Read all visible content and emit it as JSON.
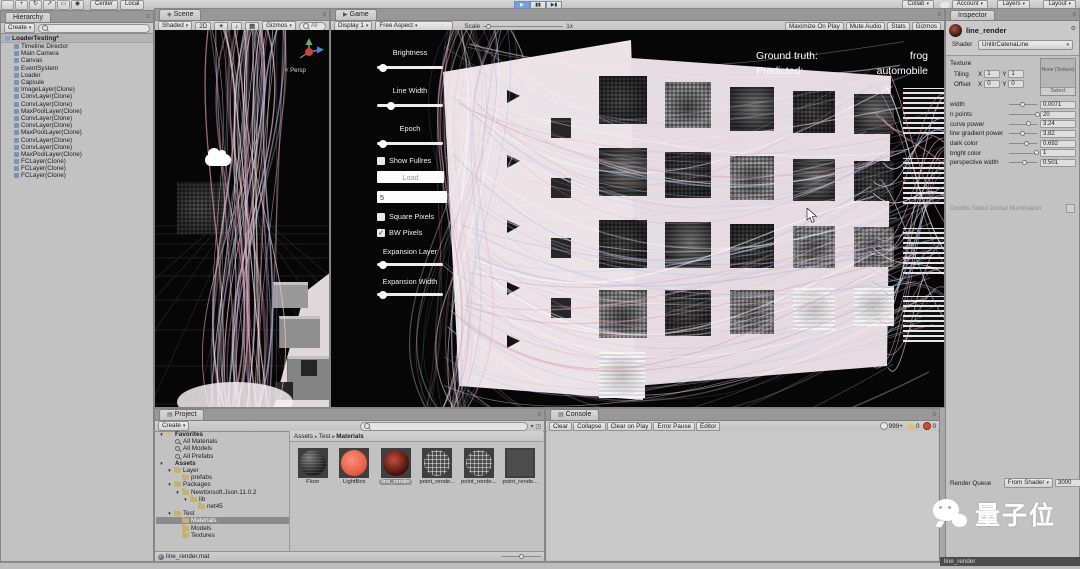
{
  "toolbar": {
    "pivot": "Center",
    "space": "Local",
    "collab": "Collab",
    "account": "Account",
    "layers": "Layers",
    "layout": "Layout"
  },
  "hierarchy": {
    "tab": "Hierarchy",
    "create_label": "Create",
    "root": "LoaderTesting*",
    "items": [
      "Timeline Director",
      "Main Camera",
      "Canvas",
      "EventSystem",
      "Loader",
      "Capsule",
      "ImageLayer(Clone)",
      "ConvLayer(Clone)",
      "ConvLayer(Clone)",
      "MaxPoolLayer(Clone)",
      "ConvLayer(Clone)",
      "ConvLayer(Clone)",
      "MaxPoolLayer(Clone)",
      "ConvLayer(Clone)",
      "ConvLayer(Clone)",
      "MaxPoolLayer(Clone)",
      "FCLayer(Clone)",
      "FCLayer(Clone)",
      "FCLayer(Clone)"
    ]
  },
  "scene": {
    "tab": "Scene",
    "shaded": "Shaded",
    "mode2d": "2D",
    "gizmos": "Gizmos",
    "search": "All",
    "persp": "< Persp"
  },
  "game": {
    "tab": "Game",
    "display": "Display 1",
    "aspect": "Free Aspect",
    "scale_label": "Scale",
    "scale_value": "1x",
    "right_buttons": [
      "Maximize On Play",
      "Mute Audio",
      "Stats",
      "Gizmos"
    ],
    "controls": {
      "brightness": "Brightness",
      "line_width": "Line Width",
      "epoch": "Epoch",
      "show_fullres": "Show Fullres",
      "load": "Load",
      "input_value": "5",
      "square_pixels": "Square Pixels",
      "bw_pixels": "BW Pixels",
      "expansion_layer": "Expansion Layer",
      "expansion_width": "Expansion Width"
    },
    "readout": {
      "gt_label": "Ground truth:",
      "gt_value": "frog",
      "pred_label": "Predicted:",
      "pred_value": "automobile"
    }
  },
  "inspector": {
    "tab": "Inspector",
    "material": "line_render",
    "shader_label": "Shader",
    "shader_value": "Unlit/CatenaLine",
    "texture_section": "Texture",
    "tiling_label": "Tiling",
    "offset_label": "Offset",
    "axis_x": "X",
    "axis_y": "Y",
    "tiling_x": "1",
    "tiling_y": "1",
    "offset_x": "0",
    "offset_y": "0",
    "texture_none": "None (Texture)",
    "select_label": "Select",
    "properties": [
      {
        "label": "width",
        "value": "0.0071",
        "pct": 38
      },
      {
        "label": "n points",
        "value": "20",
        "pct": 93
      },
      {
        "label": "curve power",
        "value": "3.24",
        "pct": 60
      },
      {
        "label": "line gradient power",
        "value": "3.82",
        "pct": 38
      },
      {
        "label": "dark color",
        "value": "0.692",
        "pct": 53
      },
      {
        "label": "bright color",
        "value": "1",
        "pct": 90
      },
      {
        "label": "perspective width",
        "value": "0.501",
        "pct": 48
      }
    ],
    "rq_label": "Render Queue",
    "rq_mode": "From Shader",
    "rq_value": "3000",
    "dsgi_label": "Double Sided Global Illumination",
    "footer": "line_render"
  },
  "project": {
    "tab": "Project",
    "create_label": "Create",
    "tree": [
      {
        "label": "Favorites",
        "indent": 0,
        "icon": "star",
        "arrow": "▼",
        "bold": true
      },
      {
        "label": "All Materials",
        "indent": 1,
        "icon": "search"
      },
      {
        "label": "All Models",
        "indent": 1,
        "icon": "search"
      },
      {
        "label": "All Prefabs",
        "indent": 1,
        "icon": "search"
      },
      {
        "label": "Assets",
        "indent": 0,
        "icon": "none",
        "arrow": "▼",
        "bold": true
      },
      {
        "label": "Layer",
        "indent": 1,
        "icon": "folder",
        "arrow": "▼"
      },
      {
        "label": "prefabs",
        "indent": 2,
        "icon": "folder"
      },
      {
        "label": "Packages",
        "indent": 1,
        "icon": "folder",
        "arrow": "▼"
      },
      {
        "label": "Newtonsoft.Json.11.0.2",
        "indent": 2,
        "icon": "folder",
        "arrow": "▼"
      },
      {
        "label": "lib",
        "indent": 3,
        "icon": "folder",
        "arrow": "▼"
      },
      {
        "label": "net45",
        "indent": 4,
        "icon": "folder"
      },
      {
        "label": "Test",
        "indent": 1,
        "icon": "folder",
        "arrow": "▼"
      },
      {
        "label": "Materials",
        "indent": 2,
        "icon": "folder",
        "selected": true
      },
      {
        "label": "Models",
        "indent": 2,
        "icon": "folder"
      },
      {
        "label": "Textures",
        "indent": 2,
        "icon": "folder"
      }
    ],
    "breadcrumb": [
      "Assets",
      "Test",
      "Materials"
    ],
    "materials": [
      {
        "name": "Floor",
        "kind": "sphere-dark"
      },
      {
        "name": "LightBox",
        "kind": "disc-orange"
      },
      {
        "name": "line_render",
        "kind": "sphere-red",
        "selected": true
      },
      {
        "name": "point_rende...",
        "kind": "sphere-wire"
      },
      {
        "name": "point_rende...",
        "kind": "sphere-wire"
      },
      {
        "name": "point_rende...",
        "kind": "square-dark"
      }
    ],
    "footer": "line_render.mat"
  },
  "console": {
    "tab": "Console",
    "buttons": [
      "Clear",
      "Collapse",
      "Clear on Play",
      "Error Pause",
      "Editor"
    ],
    "info_count": "999+",
    "warn_count": "0",
    "error_count": "0"
  },
  "status": {
    "selection": "line_render"
  },
  "watermark": {
    "text": "量子位"
  },
  "viz_colors": {
    "pinks": [
      "#e8b2c4",
      "#f2d0da",
      "#d694ae",
      "#f7e3e8"
    ],
    "blues": [
      "#aab8de",
      "#ccd4ef",
      "#b9c3e6"
    ],
    "white": "#ffffff"
  }
}
